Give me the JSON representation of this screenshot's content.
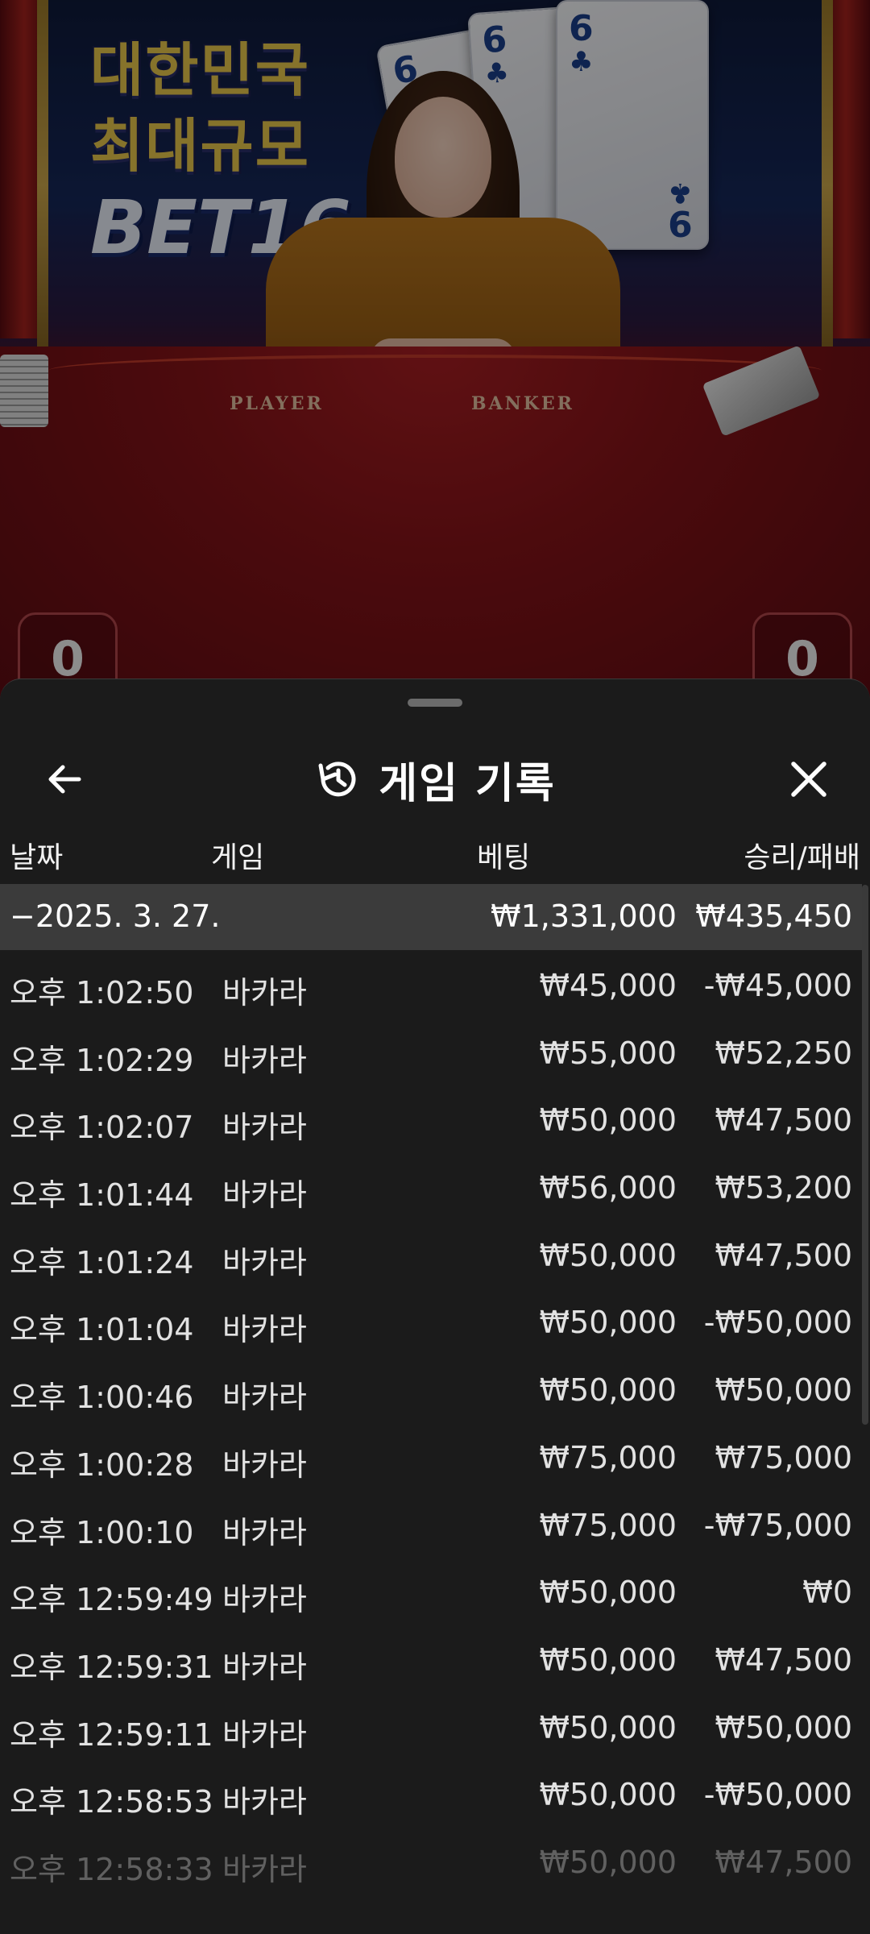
{
  "scene": {
    "promo_line1": "대한민국",
    "promo_line2": "최대규모",
    "promo_brand": "BET16",
    "table_player": "PLAYER",
    "table_banker": "BANKER",
    "card1_rank": "6",
    "card2_rank": "6",
    "card3_rank": "6",
    "card3_bottom_rank": "9",
    "card_suit": "♣",
    "score_left": "0",
    "score_right": "0"
  },
  "sheet": {
    "title": "게임 기록",
    "icons": {
      "back": "arrow-left-icon",
      "history": "history-icon",
      "close": "close-icon"
    },
    "columns": {
      "date": "날짜",
      "game": "게임",
      "bet": "베팅",
      "result": "승리/패배"
    },
    "summary": {
      "date": "−2025. 3. 27.",
      "bet": "₩1,331,000",
      "result": "₩435,450"
    },
    "rows": [
      {
        "time": "오후 1:02:50",
        "game": "바카라",
        "bet": "₩45,000",
        "result": "-₩45,000"
      },
      {
        "time": "오후 1:02:29",
        "game": "바카라",
        "bet": "₩55,000",
        "result": "₩52,250"
      },
      {
        "time": "오후 1:02:07",
        "game": "바카라",
        "bet": "₩50,000",
        "result": "₩47,500"
      },
      {
        "time": "오후 1:01:44",
        "game": "바카라",
        "bet": "₩56,000",
        "result": "₩53,200"
      },
      {
        "time": "오후 1:01:24",
        "game": "바카라",
        "bet": "₩50,000",
        "result": "₩47,500"
      },
      {
        "time": "오후 1:01:04",
        "game": "바카라",
        "bet": "₩50,000",
        "result": "-₩50,000"
      },
      {
        "time": "오후 1:00:46",
        "game": "바카라",
        "bet": "₩50,000",
        "result": "₩50,000"
      },
      {
        "time": "오후 1:00:28",
        "game": "바카라",
        "bet": "₩75,000",
        "result": "₩75,000"
      },
      {
        "time": "오후 1:00:10",
        "game": "바카라",
        "bet": "₩75,000",
        "result": "-₩75,000"
      },
      {
        "time": "오후 12:59:49",
        "game": "바카라",
        "bet": "₩50,000",
        "result": "₩0"
      },
      {
        "time": "오후 12:59:31",
        "game": "바카라",
        "bet": "₩50,000",
        "result": "₩47,500"
      },
      {
        "time": "오후 12:59:11",
        "game": "바카라",
        "bet": "₩50,000",
        "result": "₩50,000"
      },
      {
        "time": "오후 12:58:53",
        "game": "바카라",
        "bet": "₩50,000",
        "result": "-₩50,000"
      },
      {
        "time": "오후 12:58:33",
        "game": "바카라",
        "bet": "₩50,000",
        "result": "₩47,500"
      }
    ]
  }
}
